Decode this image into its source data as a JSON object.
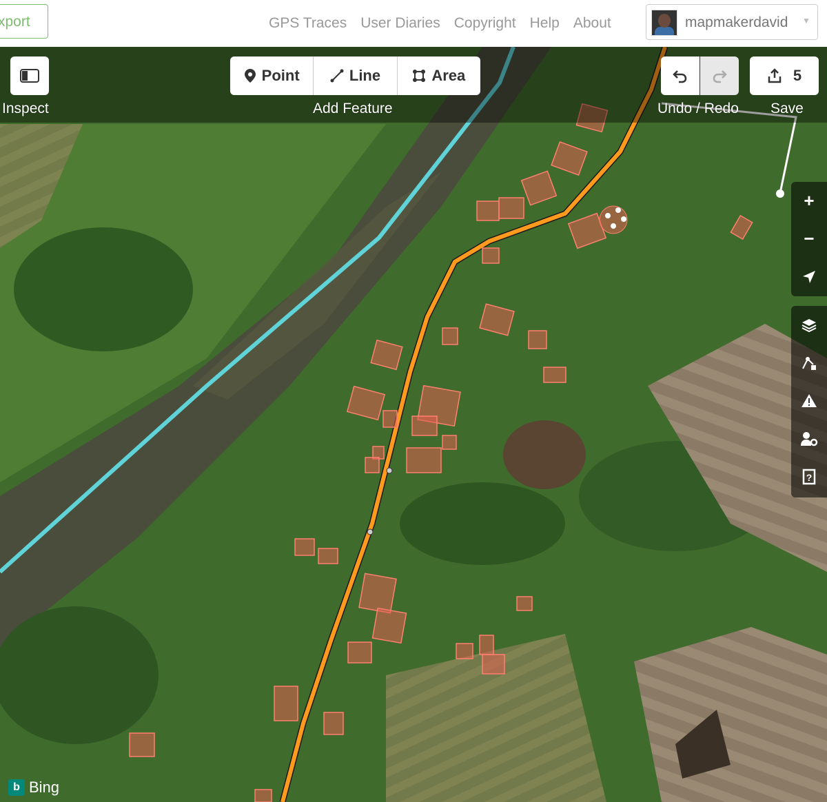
{
  "topnav": {
    "export_label": "Export",
    "links": [
      "GPS Traces",
      "User Diaries",
      "Copyright",
      "Help",
      "About"
    ],
    "username": "mapmakerdavid"
  },
  "toolbar": {
    "inspect_label": "Inspect",
    "add_feature_label": "Add Feature",
    "point_label": "Point",
    "line_label": "Line",
    "area_label": "Area",
    "undo_redo_label": "Undo / Redo",
    "save_label": "Save",
    "save_count": "5"
  },
  "map_controls": {
    "zoom_in": "+",
    "zoom_out": "−"
  },
  "attribution": {
    "imagery": "Bing"
  },
  "colors": {
    "river": "#5fd3d8",
    "road": "#ff9a1f",
    "building": "#e06050",
    "accent": "#7ebc6f"
  }
}
